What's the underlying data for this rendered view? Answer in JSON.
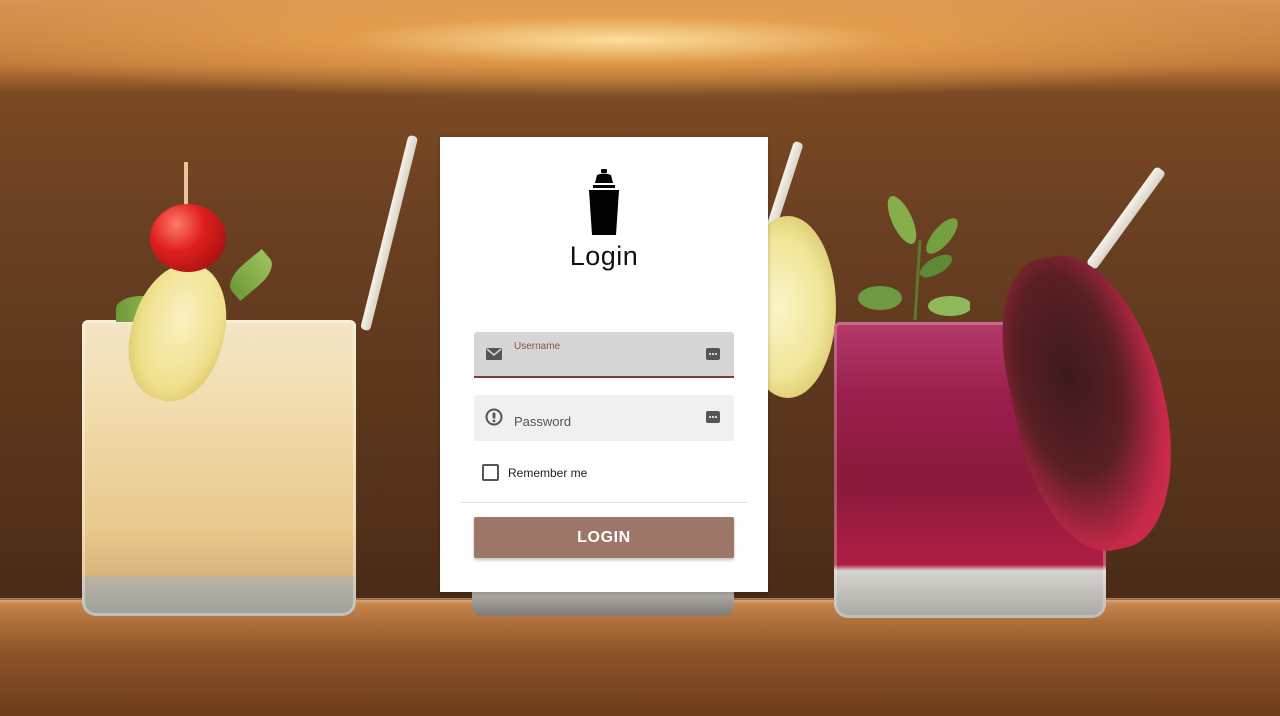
{
  "login_card": {
    "logo_icon": "cocktail-shaker-icon",
    "title": "Login",
    "username": {
      "label": "Username",
      "value": "",
      "lead_icon": "mail-icon",
      "trail_icon": "password-manager-icon"
    },
    "password": {
      "placeholder": "Password",
      "value": "",
      "lead_icon": "info-circle-icon",
      "trail_icon": "password-manager-icon"
    },
    "remember_me": {
      "label": "Remember me",
      "checked": false
    },
    "login_button": "LOGIN"
  },
  "colors": {
    "accent": "#9c7669",
    "active_underline": "#7a3e2c",
    "label": "#8a5340"
  }
}
